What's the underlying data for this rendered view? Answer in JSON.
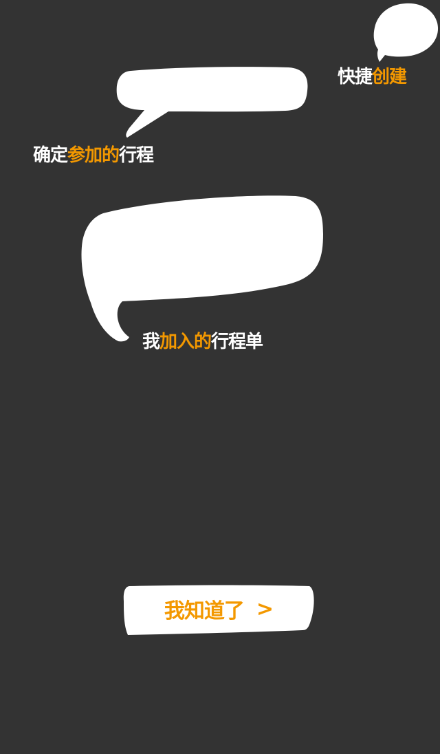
{
  "tips": {
    "quick_create": {
      "prefix": "快捷",
      "highlight": "创建"
    },
    "confirmed_trips": {
      "prefix": "确定",
      "highlight": "参加的",
      "suffix": "行程"
    },
    "joined_trips": {
      "prefix": "我",
      "highlight": "加入的",
      "suffix": "行程单"
    }
  },
  "button": {
    "label": "我知道了",
    "chevron": ">"
  },
  "colors": {
    "background": "#333333",
    "accent": "#f39800",
    "bubble": "#ffffff"
  }
}
